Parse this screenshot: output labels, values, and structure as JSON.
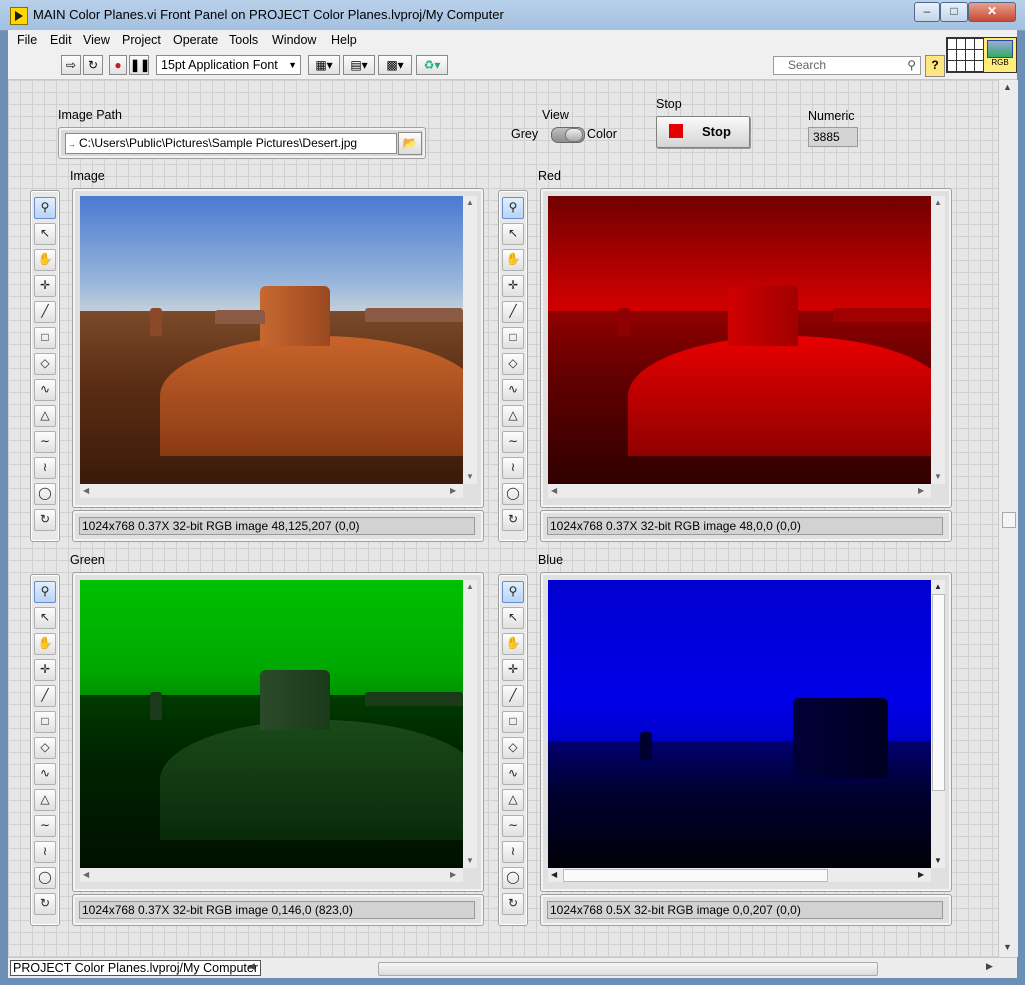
{
  "window": {
    "title": "MAIN Color Planes.vi Front Panel on PROJECT Color Planes.lvproj/My Computer",
    "minimize": "–",
    "maximize": "□",
    "close": "✕"
  },
  "menu": [
    "File",
    "Edit",
    "View",
    "Project",
    "Operate",
    "Tools",
    "Window",
    "Help"
  ],
  "toolbar": {
    "font": "15pt Application Font",
    "search_placeholder": "Search",
    "help": "?",
    "vi_icon_label": "RGB"
  },
  "controls": {
    "image_path_label": "Image Path",
    "image_path_value": "C:\\Users\\Public\\Pictures\\Sample Pictures\\Desert.jpg",
    "view_label": "View",
    "view_off": "Grey",
    "view_on": "Color",
    "view_state": "Color",
    "stop_label": "Stop",
    "stop_button": "Stop",
    "numeric_label": "Numeric",
    "numeric_value": "3885"
  },
  "displays": [
    {
      "label": "Image",
      "info": "1024x768 0.37X 32-bit RGB image 48,125,207     (0,0)",
      "tint": "natural"
    },
    {
      "label": "Red",
      "info": "1024x768 0.37X 32-bit RGB image 48,0,0       (0,0)",
      "tint": "#c00000"
    },
    {
      "label": "Green",
      "info": "1024x768 0.37X 32-bit RGB image 0,146,0      (823,0)",
      "tint": "#00c000"
    },
    {
      "label": "Blue",
      "info": "1024x768 0.5X 32-bit RGB image 0,0,207      (0,0)",
      "tint": "#0000e0"
    }
  ],
  "tool_icons": [
    "zoom-icon",
    "arrow-icon",
    "hand-icon",
    "point-icon",
    "line-icon",
    "rectangle-icon",
    "rotated-rectangle-icon",
    "freehand-icon",
    "polygon-icon",
    "bezier-icon",
    "freehand-region-icon",
    "oval-icon",
    "annulus-icon"
  ],
  "status": {
    "context": "PROJECT Color Planes.lvproj/My Computer"
  }
}
